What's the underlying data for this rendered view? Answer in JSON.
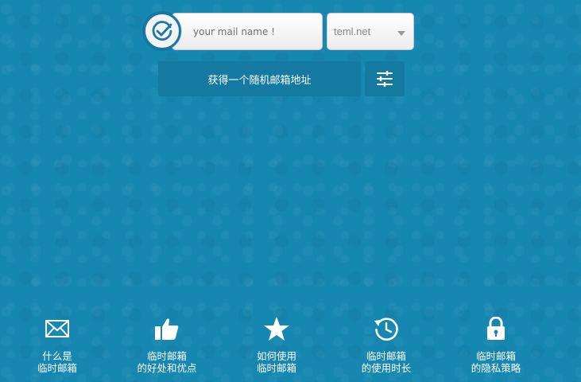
{
  "form": {
    "mail_placeholder": "your mail name !",
    "domain": "teml.net",
    "generate_label": "获得一个随机邮箱地址"
  },
  "icons": {
    "badge": "check-circle-icon",
    "domain_caret": "caret-down-icon",
    "settings": "sliders-icon"
  },
  "nav": [
    {
      "line1": "什么是",
      "line2": "临时邮箱",
      "icon": "envelope-icon"
    },
    {
      "line1": "临时邮箱",
      "line2": "的好处和优点",
      "icon": "thumbs-up-icon"
    },
    {
      "line1": "如何使用",
      "line2": "临时邮箱",
      "icon": "star-icon"
    },
    {
      "line1": "临时邮箱",
      "line2": "的使用时长",
      "icon": "history-clock-icon"
    },
    {
      "line1": "临时邮箱",
      "line2": "的隐私策略",
      "icon": "lock-icon"
    }
  ],
  "colors": {
    "background": "#1687b1",
    "button": "#147aa2",
    "badge_check": "#1f79a6"
  }
}
